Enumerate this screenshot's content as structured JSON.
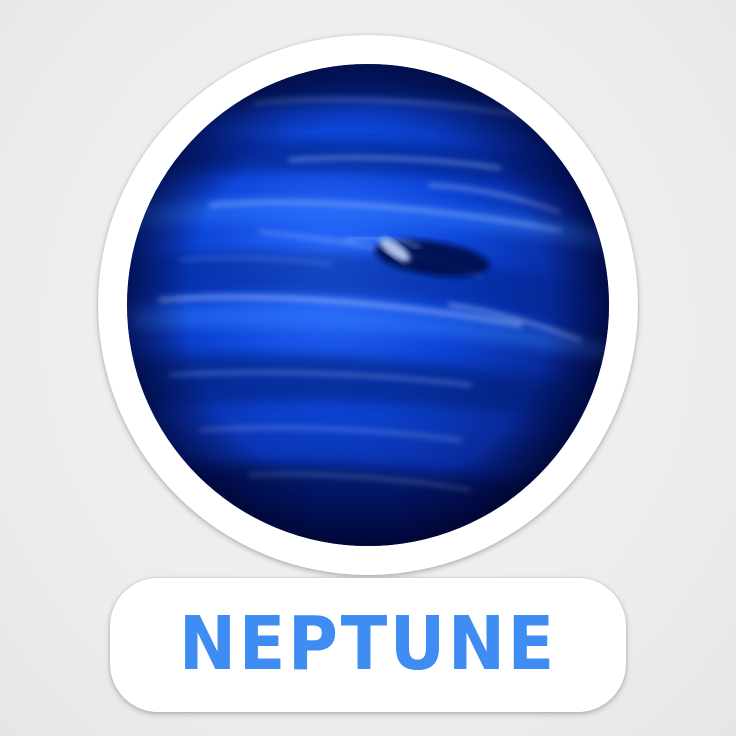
{
  "sticker": {
    "title": "NEPTUNE",
    "text_color": "#3f8df3",
    "border_color": "#ffffff",
    "background_color": "#ececec",
    "planet_colors": {
      "deep": "#04145c",
      "mid": "#0a3fcc",
      "light": "#2e78ff",
      "streak": "#a9c8ff"
    }
  }
}
